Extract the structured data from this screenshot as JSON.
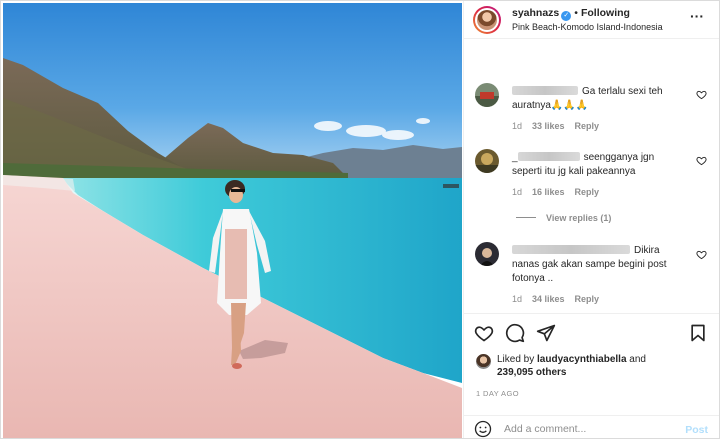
{
  "post": {
    "username": "syahnazs",
    "verified": true,
    "separator": "•",
    "follow_state": "Following",
    "location": "Pink Beach-Komodo Island-Indonesia",
    "more_icon": "more-horizontal-icon"
  },
  "comments": [
    {
      "text_1": "Ga terlalu sexi teh",
      "text_2": "auratnya",
      "emoji": "🙏🙏🙏",
      "time": "1d",
      "likes": "33 likes",
      "reply": "Reply"
    },
    {
      "prefix": "_",
      "text_1": "seengganya jgn",
      "text_2": "seperti itu jg kali pakeannya",
      "time": "1d",
      "likes": "16 likes",
      "reply": "Reply",
      "view_replies": "View replies (1)"
    },
    {
      "text_1": "Dikira",
      "text_2": "nanas gak akan sampe begini post",
      "text_3": "fotonya ..",
      "time": "1d",
      "likes": "34 likes",
      "reply": "Reply"
    }
  ],
  "actions": {
    "like_icon": "heart-icon",
    "comment_icon": "comment-icon",
    "share_icon": "send-icon",
    "save_icon": "bookmark-icon"
  },
  "likes": {
    "prefix": "Liked by",
    "user": "laudyacynthiabella",
    "conj": "and",
    "count": "239,095 others"
  },
  "timestamp": "1 DAY AGO",
  "comment_box": {
    "placeholder": "Add a comment...",
    "post_label": "Post",
    "emoji_icon": "smiley-icon"
  },
  "colors": {
    "accent_blue": "#3897f0",
    "post_disabled": "#b2dffc",
    "muted": "#8e8e8e",
    "sea": "#38c7d6",
    "sky": "#3a8fd9",
    "sand": "#f0c9c4"
  }
}
